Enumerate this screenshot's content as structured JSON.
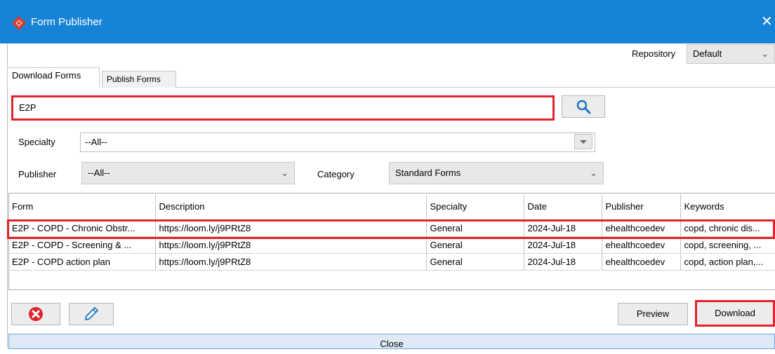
{
  "window": {
    "title": "Form Publisher",
    "close_glyph": "✕"
  },
  "repository": {
    "label": "Repository",
    "selected": "Default"
  },
  "tabs": [
    {
      "label": "Download Forms",
      "active": true
    },
    {
      "label": "Publish Forms",
      "active": false
    }
  ],
  "search": {
    "value": "E2P",
    "button_icon": "search-icon"
  },
  "filters": {
    "specialty_label": "Specialty",
    "specialty_value": "--All--",
    "publisher_label": "Publisher",
    "publisher_value": "--All--",
    "category_label": "Category",
    "category_value": "Standard Forms"
  },
  "table": {
    "columns": [
      "Form",
      "Description",
      "Specialty",
      "Date",
      "Publisher",
      "Keywords"
    ],
    "rows": [
      [
        "E2P - COPD - Chronic Obstr...",
        "https://loom.ly/j9PRtZ8",
        "General",
        "2024-Jul-18",
        "ehealthcoedev",
        "copd, chronic dis..."
      ],
      [
        "E2P - COPD - Screening & ...",
        "https://loom.ly/j9PRtZ8",
        "General",
        "2024-Jul-18",
        "ehealthcoedev",
        "copd, screening, ..."
      ],
      [
        "E2P - COPD action plan",
        "https://loom.ly/j9PRtZ8",
        "General",
        "2024-Jul-18",
        "ehealthcoedev",
        "copd, action plan,..."
      ]
    ]
  },
  "actions": {
    "delete_icon": "delete-icon",
    "edit_icon": "pencil-icon",
    "preview_label": "Preview",
    "download_label": "Download",
    "close_label": "Close"
  },
  "colors": {
    "titlebar": "#1783d6",
    "highlight": "#e0242b",
    "delete": "#e0242b",
    "pencil": "#1f6fc4"
  }
}
